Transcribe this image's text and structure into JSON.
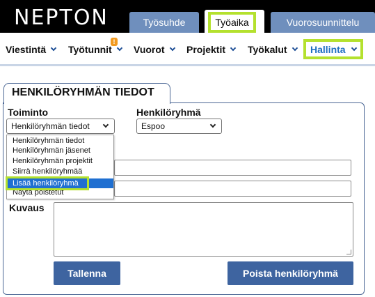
{
  "header": {
    "logo": "NEPTON",
    "tabs": [
      {
        "label": "Työsuhde"
      },
      {
        "label": "Työaika"
      },
      {
        "label": "Vuorosuunnittelu"
      }
    ]
  },
  "nav": {
    "items": [
      {
        "label": "Viestintä"
      },
      {
        "label": "Työtunnit"
      },
      {
        "label": "Vuorot"
      },
      {
        "label": "Projektit"
      },
      {
        "label": "Työkalut"
      },
      {
        "label": "Hallinta"
      }
    ],
    "badge": "!"
  },
  "panel": {
    "title": "HENKILÖRYHMÄN TIEDOT",
    "toiminto_label": "Toiminto",
    "toiminto_value": "Henkilöryhmän tiedot",
    "henkiloryhma_label": "Henkilöryhmä",
    "henkiloryhma_value": "Espoo",
    "dropdown_options": [
      "Henkilöryhmän tiedot",
      "Henkilöryhmän jäsenet",
      "Henkilöryhmän projektit",
      "Siirrä henkilöryhmää",
      "Lisää henkilöryhmä",
      "Näytä poistetut"
    ],
    "kuvaus_label": "Kuvaus",
    "save_button": "Tallenna",
    "delete_button": "Poista henkilöryhmä"
  },
  "colors": {
    "accent_highlight": "#b4e12e",
    "tab_blue": "#6f8fbd",
    "button_blue": "#3e64a0",
    "selected_option": "#1f6fd1",
    "hallinta_text": "#1f6fc1"
  }
}
